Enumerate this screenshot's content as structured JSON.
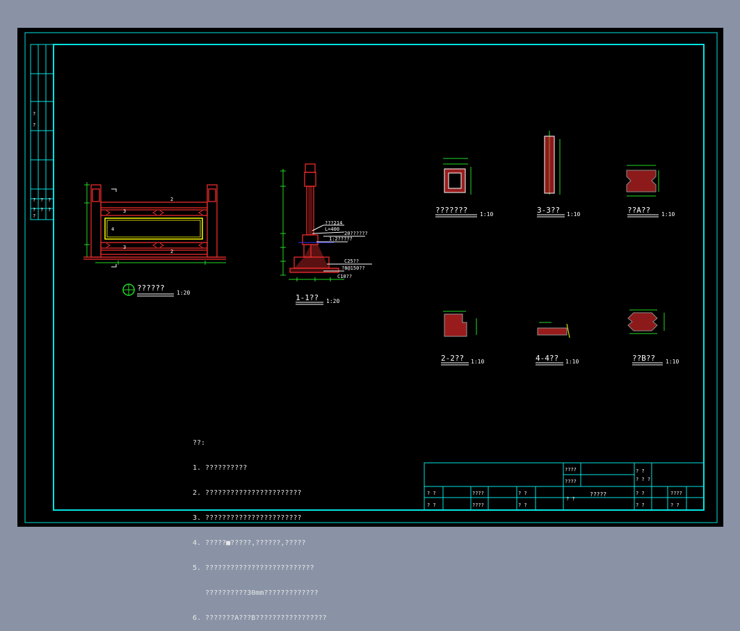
{
  "colors": {
    "frame": "#00e5e5",
    "drawing": "#ff3030",
    "dim": "#22dd22",
    "text": "#ffffff",
    "hatch": "#ff3030",
    "background": "#000000"
  },
  "views": {
    "elevation": {
      "title": "??????",
      "scale": "1:20",
      "marks": [
        "2",
        "2",
        "3",
        "3",
        "4"
      ]
    },
    "section_1": {
      "title": "1-1??",
      "scale": "1:20",
      "labels": [
        "???214",
        "L=400",
        "20??????",
        "1:2?????",
        "C25??",
        "?8@150??",
        "C10??"
      ]
    },
    "railing_section": {
      "title": "???????",
      "scale": "1:10"
    },
    "section_3": {
      "title": "3-3??",
      "scale": "1:10"
    },
    "detail_a": {
      "title": "??A??",
      "scale": "1:10"
    },
    "section_2": {
      "title": "2-2??",
      "scale": "1:10"
    },
    "section_4": {
      "title": "4-4??",
      "scale": "1:10"
    },
    "detail_b": {
      "title": "??B??",
      "scale": "1:10"
    }
  },
  "notes": {
    "heading": "??:",
    "lines": [
      "1. ??????????",
      "2. ???????????????????????",
      "3. ???????????????????????",
      "4. ?????■?????,??????,?????",
      "5. ??????????????????????????",
      "   ??????????30mm?????????????",
      "6. ???????A???B?????????????????"
    ]
  },
  "title_block": {
    "cells": [
      "????",
      "????",
      "? ?",
      "????",
      "? ?",
      "? ?",
      "????",
      "? ?",
      "? ?",
      "????",
      "? ?",
      "?????",
      "? ? ?",
      "? ?",
      "? ?",
      "????",
      "? ?",
      "? ?"
    ],
    "drawing_name": "?????"
  },
  "revision_strip": {
    "cells": [
      "?",
      "?",
      "?",
      "?",
      "?",
      "?",
      "?",
      "?",
      "?"
    ]
  }
}
